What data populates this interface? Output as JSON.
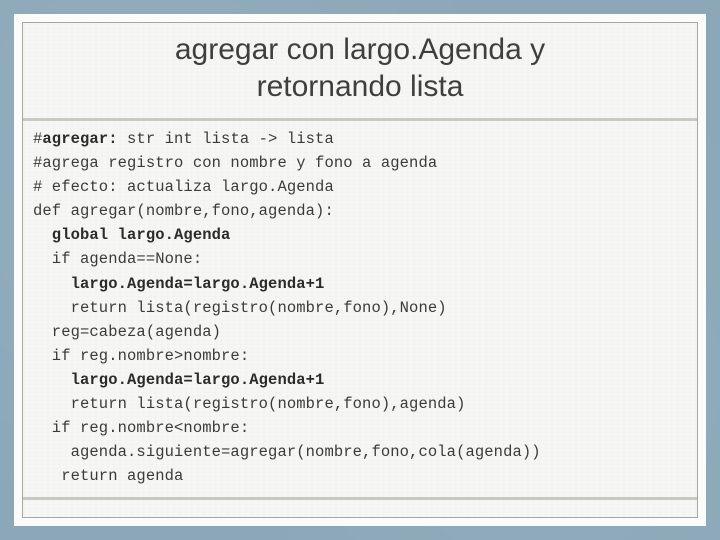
{
  "slide": {
    "title": "agregar con largo.Agenda y\nretornando lista",
    "title_line_1": "agregar con largo.Agenda y",
    "title_line_2": "retornando lista",
    "frame_color": "#8ca8b8",
    "paper_color": "#fbfbfa",
    "rule_color": "#c9c9c2",
    "border_color": "#a9a89e",
    "text_color": "#3f3f3f"
  },
  "code": {
    "language": "python",
    "lines": [
      {
        "id": "line-1",
        "indent": 0,
        "bold": false,
        "prefix": "#",
        "emphasis": "agregar:",
        "text": "#agregar: str int lista -> lista",
        "plain_after": " str int lista -> lista"
      },
      {
        "id": "line-2",
        "indent": 0,
        "bold": false,
        "text": "#agrega registro con nombre y fono a agenda"
      },
      {
        "id": "line-3",
        "indent": 0,
        "bold": false,
        "text": "# efecto: actualiza largo.Agenda"
      },
      {
        "id": "line-4",
        "indent": 0,
        "bold": false,
        "text": "def agregar(nombre,fono,agenda):"
      },
      {
        "id": "line-5",
        "indent": 2,
        "bold": true,
        "text": "  global largo.Agenda"
      },
      {
        "id": "line-6",
        "indent": 2,
        "bold": false,
        "text": "  if agenda==None:"
      },
      {
        "id": "line-7",
        "indent": 4,
        "bold": true,
        "text": "    largo.Agenda=largo.Agenda+1"
      },
      {
        "id": "line-8",
        "indent": 4,
        "bold": false,
        "text": "    return lista(registro(nombre,fono),None)"
      },
      {
        "id": "line-9",
        "indent": 2,
        "bold": false,
        "text": "  reg=cabeza(agenda)"
      },
      {
        "id": "line-10",
        "indent": 2,
        "bold": false,
        "text": "  if reg.nombre>nombre:"
      },
      {
        "id": "line-11",
        "indent": 4,
        "bold": true,
        "text": "    largo.Agenda=largo.Agenda+1"
      },
      {
        "id": "line-12",
        "indent": 4,
        "bold": false,
        "text": "    return lista(registro(nombre,fono),agenda)"
      },
      {
        "id": "line-13",
        "indent": 2,
        "bold": false,
        "text": "  if reg.nombre<nombre:"
      },
      {
        "id": "line-14",
        "indent": 4,
        "bold": false,
        "text": "    agenda.siguiente=agregar(nombre,fono,cola(agenda))"
      },
      {
        "id": "line-15",
        "indent": 3,
        "bold": false,
        "text": "   return agenda"
      }
    ]
  }
}
